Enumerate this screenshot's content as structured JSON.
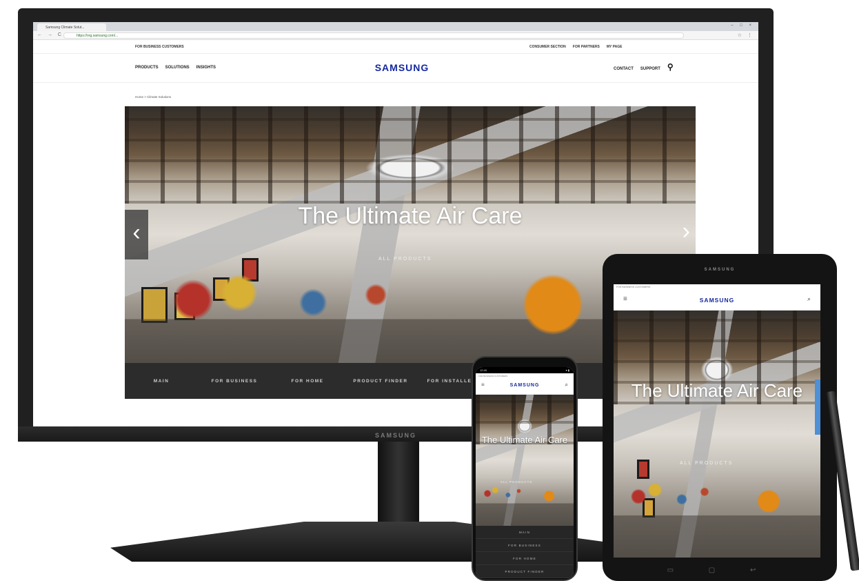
{
  "browser": {
    "tab_title": "Samsung Climate Solut...",
    "window_controls": "– □ ×",
    "nav_buttons": "← → C",
    "url": "https://org.samsung.com/...",
    "actions": "☆ ⋮"
  },
  "site": {
    "util_left": "FOR BUSINESS CUSTOMERS",
    "util_links": [
      "CONSUMER SECTION",
      "FOR PARTNERS",
      "MY PAGE"
    ],
    "nav_left": [
      "PRODUCTS",
      "SOLUTIONS",
      "INSIGHTS"
    ],
    "brand": "SAMSUNG",
    "nav_right": [
      "CONTACT",
      "SUPPORT"
    ],
    "breadcrumb": "Home > Climate Solutions"
  },
  "hero": {
    "title": "The Ultimate Air Care",
    "link": "ALL PRODUCTS",
    "prev": "‹",
    "next": "›"
  },
  "tabs": [
    "MAIN",
    "FOR BUSINESS",
    "FOR HOME",
    "PRODUCT FINDER",
    "FOR INSTALLERS"
  ],
  "devices": {
    "monitor_brand": "SAMSUNG",
    "tablet_brand": "SAMSUNG",
    "tablet_nav": "▭ ▢ ↩"
  },
  "tablet": {
    "topline": "FOR BUSINESS CUSTOMERS",
    "brand": "SAMSUNG",
    "menu_icon": "≡",
    "search_icon": "⌕",
    "hero_title": "The Ultimate Air Care",
    "hero_link": "ALL PRODUCTS"
  },
  "phone": {
    "status_time": "12:45",
    "status_icons": "▾ ▮",
    "topline": "FOR BUSINESS CUSTOMERS",
    "brand": "SAMSUNG",
    "menu_icon": "≡",
    "search_icon": "⌕",
    "hero_title": "The Ultimate Air Care",
    "hero_link": "ALL PRODUCTS",
    "menu": [
      "MAIN",
      "FOR BUSINESS",
      "FOR HOME",
      "PRODUCT FINDER"
    ]
  },
  "icons": {
    "search": "search-icon",
    "menu": "hamburger-menu-icon",
    "prev": "chevron-left-icon",
    "next": "chevron-right-icon"
  },
  "colors": {
    "brand_blue": "#1428a0",
    "tab_strip": "#2c2c2c",
    "device_black": "#141414"
  }
}
